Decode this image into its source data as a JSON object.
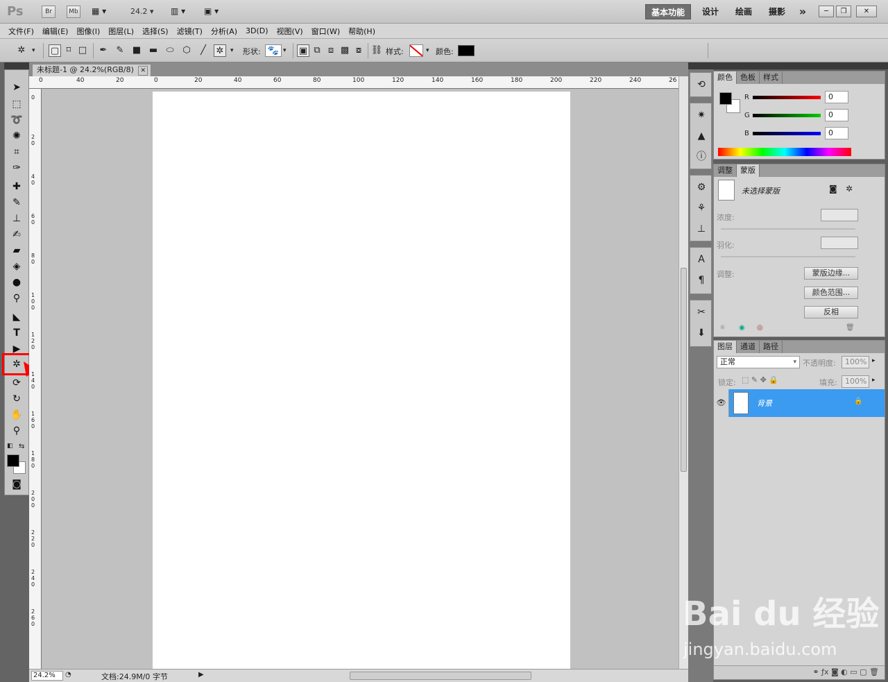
{
  "titlebar": {
    "logo": "Ps",
    "bridge": "Br",
    "minibridge": "Mb",
    "zoom": "24.2",
    "workspaces": [
      "基本功能",
      "设计",
      "绘画",
      "摄影"
    ],
    "more": "»",
    "win": [
      "─",
      "❐",
      "✕"
    ]
  },
  "menu": [
    "文件(F)",
    "编辑(E)",
    "图像(I)",
    "图层(L)",
    "选择(S)",
    "滤镜(T)",
    "分析(A)",
    "3D(D)",
    "视图(V)",
    "窗口(W)",
    "帮助(H)"
  ],
  "options": {
    "shape_label": "形状:",
    "style_label": "样式:",
    "color_label": "颜色:",
    "color_value": "#000000"
  },
  "document": {
    "tab_title": "未标题-1 @ 24.2%(RGB/8)",
    "close": "✕",
    "ruler_h": [
      "0",
      "40",
      "20",
      "0",
      "20",
      "40",
      "60",
      "80",
      "100",
      "120",
      "140",
      "160",
      "180",
      "200",
      "220",
      "240",
      "26"
    ],
    "ruler_v": [
      "0",
      "2\n0",
      "4\n0",
      "6\n0",
      "8\n0",
      "1\n0\n0",
      "1\n2\n0",
      "1\n4\n0",
      "1\n6\n0",
      "1\n8\n0",
      "2\n0\n0",
      "2\n2\n0",
      "2\n4\n0",
      "2\n6\n0"
    ]
  },
  "status": {
    "zoom": "24.2%",
    "doc": "文档:24.9M/0 字节"
  },
  "color_panel": {
    "tabs": [
      "颜色",
      "色板",
      "样式"
    ],
    "channels": [
      {
        "name": "R",
        "value": "0",
        "color": "#ff0000"
      },
      {
        "name": "G",
        "value": "0",
        "color": "#00cc00"
      },
      {
        "name": "B",
        "value": "0",
        "color": "#0000ff"
      }
    ],
    "fg": "#000000",
    "bg": "#ffffff"
  },
  "mask_panel": {
    "tabs": [
      "调整",
      "蒙版"
    ],
    "status": "未选择蒙版",
    "density_label": "浓度:",
    "feather_label": "羽化:",
    "adjust_label": "调整:",
    "btn_edge": "蒙版边缘...",
    "btn_range": "颜色范围...",
    "btn_invert": "反相"
  },
  "layers_panel": {
    "tabs": [
      "图层",
      "通道",
      "路径"
    ],
    "blend": "正常",
    "opacity_label": "不透明度:",
    "opacity": "100%",
    "lock_label": "锁定:",
    "fill_label": "填充:",
    "fill": "100%",
    "layer_name": "背景",
    "accent": "#3a9bf0"
  },
  "watermark": {
    "logo": "Bai du 经验",
    "url": "jingyan.baidu.com"
  }
}
